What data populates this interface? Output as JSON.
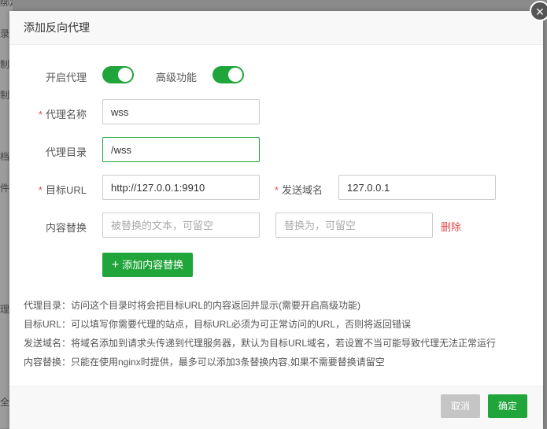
{
  "background": {
    "fragments": [
      "绑定",
      "录",
      "制",
      "制",
      "档",
      "件",
      "理",
      "全"
    ]
  },
  "dialog": {
    "title": "添加反向代理",
    "close_glyph": "×"
  },
  "form": {
    "enable_proxy_label": "开启代理",
    "enable_proxy_on": true,
    "advanced_label": "高级功能",
    "advanced_on": true,
    "proxy_name_label": "代理名称",
    "proxy_name_value": "wss",
    "proxy_dir_label": "代理目录",
    "proxy_dir_value": "/wss",
    "target_url_label": "目标URL",
    "target_url_value": "http://127.0.0.1:9910",
    "send_domain_label": "发送域名",
    "send_domain_value": "127.0.0.1",
    "content_replace_label": "内容替换",
    "replace_from_placeholder": "被替换的文本，可留空",
    "replace_to_placeholder": "替换为，可留空",
    "delete_label": "删除",
    "required_mark": "*",
    "add_replace_label": "添加内容替换",
    "add_replace_glyph": "+"
  },
  "help": [
    "代理目录：访问这个目录时将会把目标URL的内容返回并显示(需要开启高级功能)",
    "目标URL：可以填写你需要代理的站点，目标URL必须为可正常访问的URL，否则将返回错误",
    "发送域名：将域名添加到请求头传递到代理服务器，默认为目标URL域名，若设置不当可能导致代理无法正常运行",
    "内容替换：只能在使用nginx时提供，最多可以添加3条替换内容,如果不需要替换请留空"
  ],
  "footer": {
    "cancel_label": "取消",
    "confirm_label": "确定"
  },
  "colors": {
    "accent": "#20a53a",
    "danger": "#e34a4a"
  }
}
